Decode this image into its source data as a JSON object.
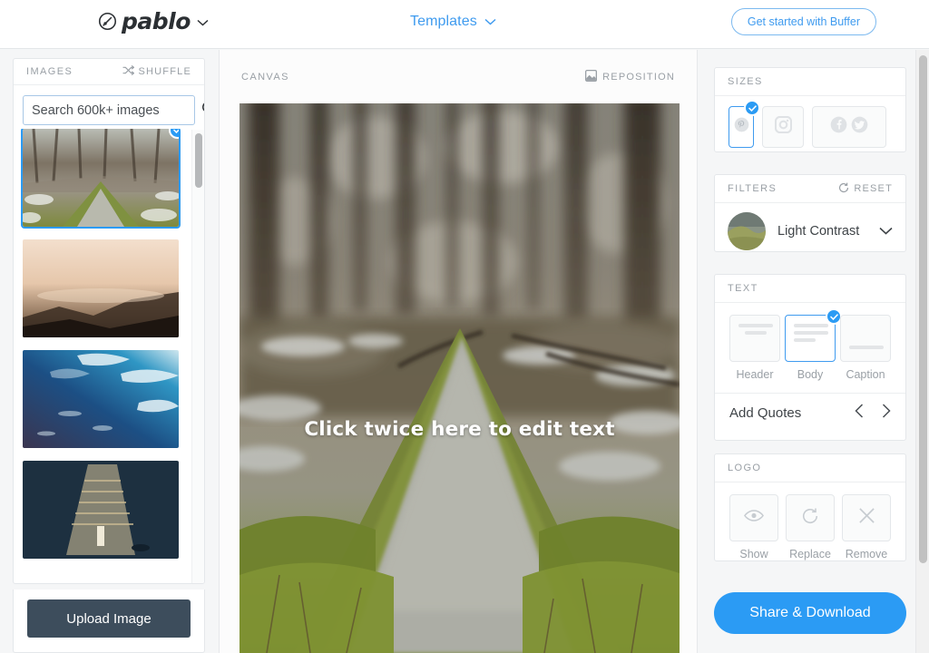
{
  "app": {
    "brand_name": "pablo",
    "brand_icon": "pablo-circle-slash-logo",
    "brand_caret_icon": "chevron-down-icon"
  },
  "topbar": {
    "templates_label": "Templates",
    "templates_caret_icon": "chevron-down-icon",
    "cta_label": "Get started with Buffer",
    "accent_color": "#3f9bef"
  },
  "images_panel": {
    "title": "IMAGES",
    "shuffle_label": "SHUFFLE",
    "shuffle_icon": "shuffle-icon",
    "search": {
      "value": "",
      "placeholder": "Search 600k+ images",
      "icon": "search-icon"
    },
    "thumbnails": [
      {
        "name": "forest-path-mossy-trail",
        "selected": true,
        "check_icon": "check-icon"
      },
      {
        "name": "golden-misty-mountain-sunrise",
        "selected": false,
        "check_icon": "check-icon"
      },
      {
        "name": "blue-ocean-wave-underwater",
        "selected": false,
        "check_icon": "check-icon"
      },
      {
        "name": "dark-stairway-light-figure",
        "selected": false,
        "check_icon": "check-icon"
      }
    ],
    "upload_label": "Upload Image",
    "scrollbar_name": "images-scrollbar"
  },
  "canvas": {
    "title": "CANVAS",
    "reposition_label": "REPOSITION",
    "reposition_icon": "reposition-icon",
    "overlay_text": "Click twice here to edit text",
    "image_name": "forest-path-mossy-trail"
  },
  "sizes": {
    "title": "SIZES",
    "options": [
      {
        "label": "Pinterest",
        "icon": "pinterest-icon",
        "selected": true,
        "check_icon": "check-icon"
      },
      {
        "label": "Instagram",
        "icon": "instagram-icon",
        "selected": false,
        "check_icon": "check-icon"
      },
      {
        "label": "Facebook & Twitter",
        "icon": "facebook-twitter-icon",
        "selected": false,
        "check_icon": "check-icon"
      }
    ]
  },
  "filters": {
    "title": "FILTERS",
    "reset_label": "RESET",
    "reset_icon": "reset-circle-icon",
    "selected_name": "Light Contrast",
    "caret_icon": "chevron-down-icon",
    "swatch_name": "filter-preview-thumbnail"
  },
  "text": {
    "title": "TEXT",
    "options": [
      {
        "label": "Header",
        "selected": false,
        "check_icon": "check-icon"
      },
      {
        "label": "Body",
        "selected": true,
        "check_icon": "check-icon"
      },
      {
        "label": "Caption",
        "selected": false,
        "check_icon": "check-icon"
      }
    ],
    "quotes_label": "Add Quotes",
    "prev_icon": "chevron-left-icon",
    "next_icon": "chevron-right-icon"
  },
  "logo": {
    "title": "LOGO",
    "options": [
      {
        "label": "Show",
        "icon": "eye-icon"
      },
      {
        "label": "Replace",
        "icon": "refresh-icon"
      },
      {
        "label": "Remove",
        "icon": "close-x-icon"
      }
    ]
  },
  "footer": {
    "share_label": "Share & Download",
    "share_color": "#2b9bf4"
  }
}
